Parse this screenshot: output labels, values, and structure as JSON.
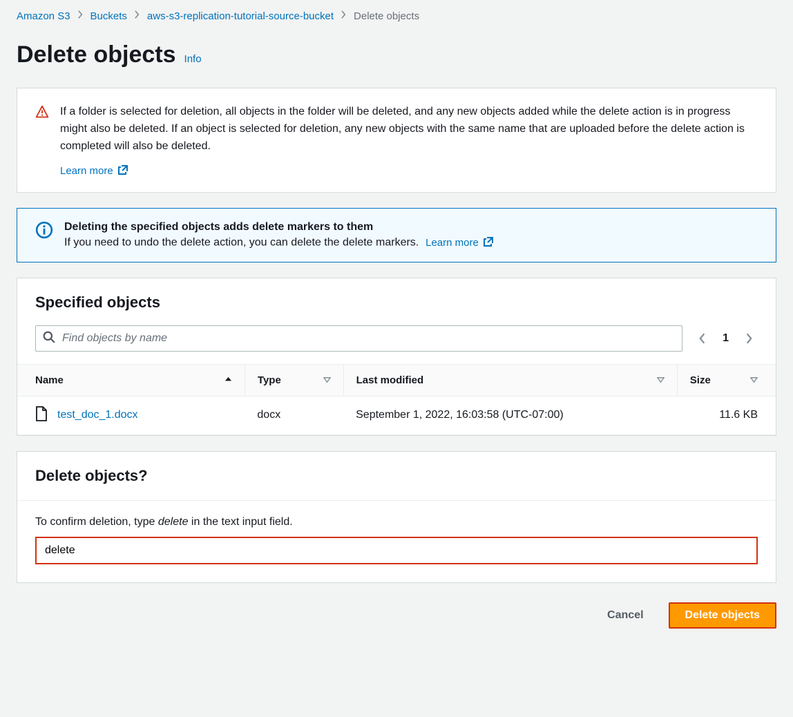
{
  "breadcrumb": {
    "items": [
      "Amazon S3",
      "Buckets",
      "aws-s3-replication-tutorial-source-bucket"
    ],
    "current": "Delete objects"
  },
  "page": {
    "title": "Delete objects",
    "info_label": "Info"
  },
  "warning": {
    "text": "If a folder is selected for deletion, all objects in the folder will be deleted, and any new objects added while the delete action is in progress might also be deleted. If an object is selected for deletion, any new objects with the same name that are uploaded before the delete action is completed will also be deleted.",
    "learn_more": "Learn more"
  },
  "info_banner": {
    "title": "Deleting the specified objects adds delete markers to them",
    "desc": "If you need to undo the delete action, you can delete the delete markers.",
    "learn_more": "Learn more"
  },
  "specified": {
    "heading": "Specified objects",
    "search_placeholder": "Find objects by name",
    "pager": {
      "page": "1"
    },
    "columns": {
      "name": "Name",
      "type": "Type",
      "modified": "Last modified",
      "size": "Size"
    },
    "rows": [
      {
        "name": "test_doc_1.docx",
        "type": "docx",
        "modified": "September 1, 2022, 16:03:58 (UTC-07:00)",
        "size": "11.6 KB"
      }
    ]
  },
  "confirm": {
    "heading": "Delete objects?",
    "prompt_pre": "To confirm deletion, type ",
    "prompt_em": "delete",
    "prompt_post": " in the text input field.",
    "value": "delete"
  },
  "footer": {
    "cancel": "Cancel",
    "delete": "Delete objects"
  }
}
